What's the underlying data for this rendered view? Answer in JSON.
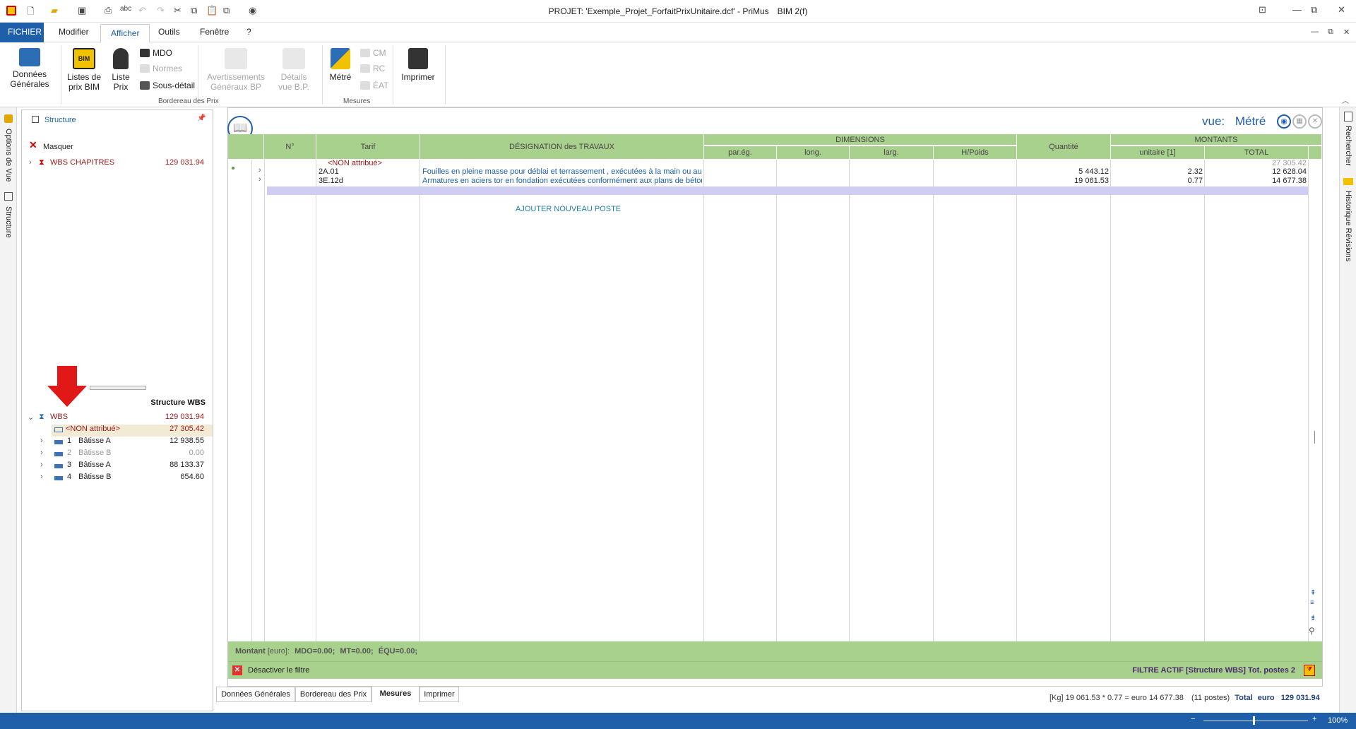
{
  "window": {
    "title": "PROJET: 'Exemple_Projet_ForfaitPrixUnitaire.dcf' - PriMus",
    "edition": "BIM 2(f)"
  },
  "ribbon_tabs": [
    "FICHIER",
    "Modifier",
    "Afficher",
    "Outils",
    "Fenêtre",
    "?"
  ],
  "ribbon": {
    "donnees": "Données\nGénérales",
    "listes_bim": "Listes de\nprix BIM",
    "liste_prix": "Liste\nPrix",
    "mdo": "MDO",
    "normes": "Normes",
    "sous_detail": "Sous-détail",
    "avertissements": "Avertissements\nGénéraux BP",
    "details": "Détails\nvue B.P.",
    "group_bordereau": "Bordereau des Prix",
    "metre": "Métré",
    "cm": "CM",
    "rc": "RC",
    "eat": "ÉAT",
    "group_mesures": "Mesures",
    "imprimer": "Imprimer"
  },
  "left_strip": {
    "options": "Options de Vue",
    "structure": "Structure"
  },
  "right_strip": {
    "rechercher": "Rechercher",
    "historique": "Historique Révisions"
  },
  "left_panel": {
    "header": "Structure",
    "masquer": "Masquer",
    "wbs_chapitres": {
      "label": "WBS CHAPITRES",
      "value": "129 031.94"
    },
    "structure_wbs_title": "Structure WBS",
    "wbs_root": {
      "label": "WBS",
      "value": "129 031.94"
    },
    "tree": [
      {
        "num": "",
        "label": "<NON attribué>",
        "value": "27 305.42"
      },
      {
        "num": "1",
        "label": "Bâtisse A",
        "value": "12 938.55"
      },
      {
        "num": "2",
        "label": "Bâtisse B",
        "value": "0.00"
      },
      {
        "num": "3",
        "label": "Bâtisse A",
        "value": "88 133.37"
      },
      {
        "num": "4",
        "label": "Bâtisse B",
        "value": "654.60"
      }
    ]
  },
  "vue": {
    "label": "vue:",
    "value": "Métré"
  },
  "grid_headers": {
    "num": "N°",
    "tarif": "Tarif",
    "designation": "DÉSIGNATION des TRAVAUX",
    "dimensions": "DIMENSIONS",
    "pareg": "par.ég.",
    "long": "long.",
    "larg": "larg.",
    "hpoids": "H/Poids",
    "quantite": "Quantité",
    "montants": "MONTANTS",
    "unitaire": "unitaire [1]",
    "total": "TOTAL"
  },
  "grid": {
    "non_attribue": "<NON attribué>",
    "non_attribue_total": "27 305.42",
    "rows": [
      {
        "tarif": "2A.01",
        "designation": "Fouilles en pleine masse pour déblai et  terrassement , exécutées à la main ou aux",
        "quantite": "5 443.12",
        "unitaire": "2.32",
        "total": "12 628.04"
      },
      {
        "tarif": "3E.12d",
        "designation": "Armatures en aciers tor en fondation exécutées conformément aux plans de bétor",
        "quantite": "19 061.53",
        "unitaire": "0.77",
        "total": "14 677.38"
      }
    ],
    "add_post": "AJOUTER NOUVEAU POSTE"
  },
  "footer": {
    "montant": "Montant",
    "montant_unit": "[euro]:",
    "mdo": "MDO=0.00;",
    "mt": "MT=0.00;",
    "equ": "ÉQU=0.00;",
    "desactiver": "Désactiver le filtre",
    "filtre": "FILTRE ACTIF [Structure WBS] Tot. postes 2"
  },
  "bottom_tabs": [
    "Données Générales",
    "Bordereau des Prix",
    "Mesures",
    "Imprimer"
  ],
  "bottom_status": {
    "calc": "[Kg] 19 061.53 * 0.77 = euro 14 677.38",
    "postes": "(11 postes)",
    "total_lbl": "Total",
    "euro": "euro",
    "total": "129 031.94"
  },
  "statusbar": {
    "zoom": "100%"
  },
  "colors": {
    "accent": "#1f5ea8",
    "grid_header": "#a9d18e",
    "wbs_red": "#9b1b1b",
    "link_blue": "#1f5ea8"
  }
}
